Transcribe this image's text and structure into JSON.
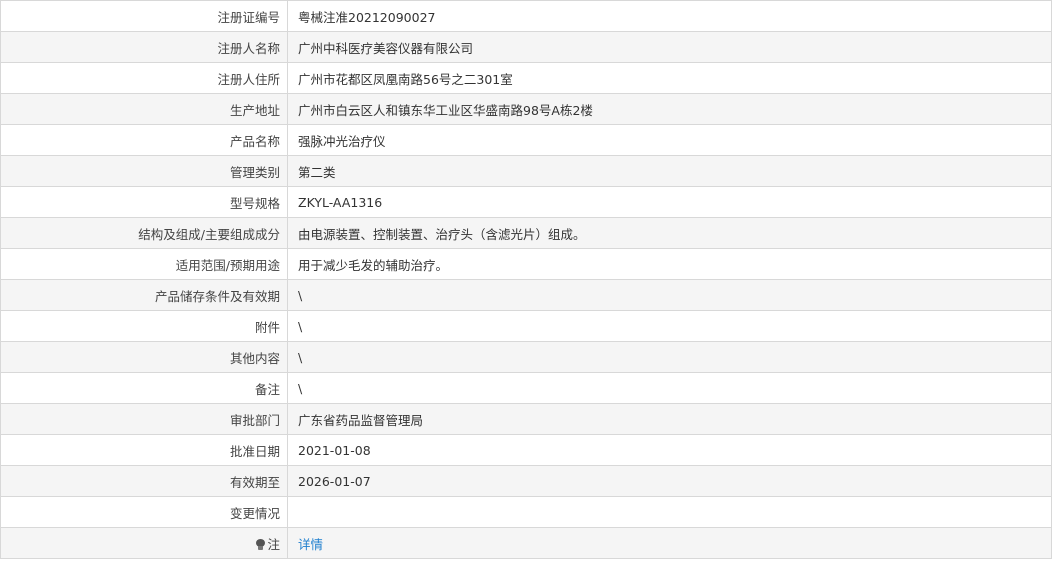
{
  "record": {
    "rows": [
      {
        "label": "注册证编号",
        "value": "粤械注准20212090027"
      },
      {
        "label": "注册人名称",
        "value": "广州中科医疗美容仪器有限公司"
      },
      {
        "label": "注册人住所",
        "value": "广州市花都区凤凰南路56号之二301室"
      },
      {
        "label": "生产地址",
        "value": "广州市白云区人和镇东华工业区华盛南路98号A栋2楼"
      },
      {
        "label": "产品名称",
        "value": "强脉冲光治疗仪"
      },
      {
        "label": "管理类别",
        "value": "第二类"
      },
      {
        "label": "型号规格",
        "value": "ZKYL-AA1316"
      },
      {
        "label": "结构及组成/主要组成成分",
        "value": "由电源装置、控制装置、治疗头（含滤光片）组成。"
      },
      {
        "label": "适用范围/预期用途",
        "value": "用于减少毛发的辅助治疗。"
      },
      {
        "label": "产品储存条件及有效期",
        "value": "\\"
      },
      {
        "label": "附件",
        "value": "\\"
      },
      {
        "label": "其他内容",
        "value": "\\"
      },
      {
        "label": "备注",
        "value": "\\"
      },
      {
        "label": "审批部门",
        "value": "广东省药品监督管理局"
      },
      {
        "label": "批准日期",
        "value": "2021-01-08"
      },
      {
        "label": "有效期至",
        "value": "2026-01-07"
      },
      {
        "label": "变更情况",
        "value": ""
      }
    ],
    "note_row": {
      "label": "注",
      "link_text": "详情",
      "icon": "lightbulb-icon"
    }
  },
  "colors": {
    "border": "#d8d8d8",
    "row_alt_background": "#f5f5f5",
    "link": "#1f7fce"
  }
}
